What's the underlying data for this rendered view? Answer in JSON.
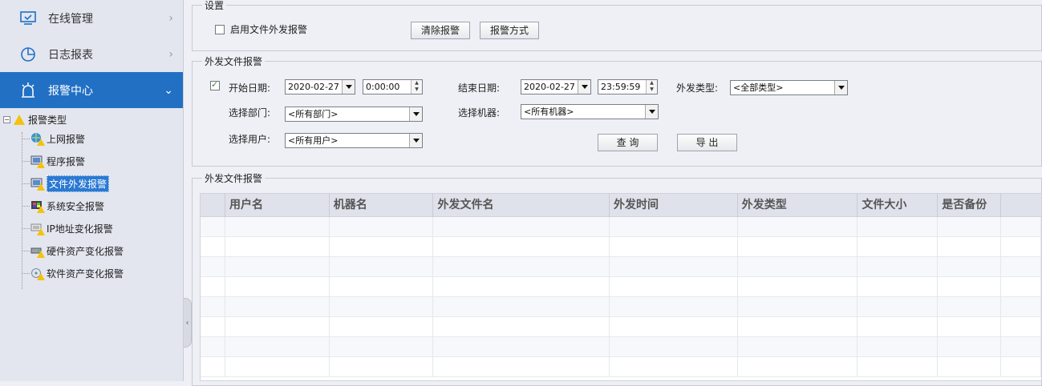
{
  "sidebar": {
    "nav": [
      {
        "label": "在线管理",
        "icon": "monitor-check-icon"
      },
      {
        "label": "日志报表",
        "icon": "pie-chart-icon"
      },
      {
        "label": "报警中心",
        "icon": "alarm-icon"
      }
    ],
    "tree": {
      "root_label": "报警类型",
      "expander": "⊟",
      "items": [
        {
          "label": "上网报警",
          "icon": "globe-warning-icon"
        },
        {
          "label": "程序报警",
          "icon": "program-warning-icon"
        },
        {
          "label": "文件外发报警",
          "icon": "file-send-warning-icon"
        },
        {
          "label": "系统安全报警",
          "icon": "system-security-warning-icon"
        },
        {
          "label": "IP地址变化报警",
          "icon": "ip-change-warning-icon"
        },
        {
          "label": "硬件资产变化报警",
          "icon": "hardware-change-warning-icon"
        },
        {
          "label": "软件资产变化报警",
          "icon": "software-change-warning-icon"
        }
      ]
    },
    "collapse_glyph": "‹"
  },
  "settings": {
    "title": "设置",
    "enable_checkbox_label": "启用文件外发报警",
    "enable_checked": false,
    "clear_button": "清除报警",
    "method_button": "报警方式"
  },
  "filter": {
    "title": "外发文件报警",
    "start_checked": true,
    "start_label": "开始日期:",
    "start_date": "2020-02-27",
    "start_time": "0:00:00",
    "end_label": "结束日期:",
    "end_date": "2020-02-27",
    "end_time": "23:59:59",
    "type_label": "外发类型:",
    "type_value": "<全部类型>",
    "dept_label": "选择部门:",
    "dept_value": "<所有部门>",
    "machine_label": "选择机器:",
    "machine_value": "<所有机器>",
    "user_label": "选择用户:",
    "user_value": "<所有用户>",
    "query_button": "查 询",
    "export_button": "导 出"
  },
  "results": {
    "title": "外发文件报警",
    "columns": [
      "",
      "用户名",
      "机器名",
      "外发文件名",
      "外发时间",
      "外发类型",
      "文件大小",
      "是否备份",
      ""
    ],
    "rows": 8
  },
  "colors": {
    "accent": "#2170c4",
    "selected": "#2a79d3",
    "warning": "#f5c20b"
  }
}
